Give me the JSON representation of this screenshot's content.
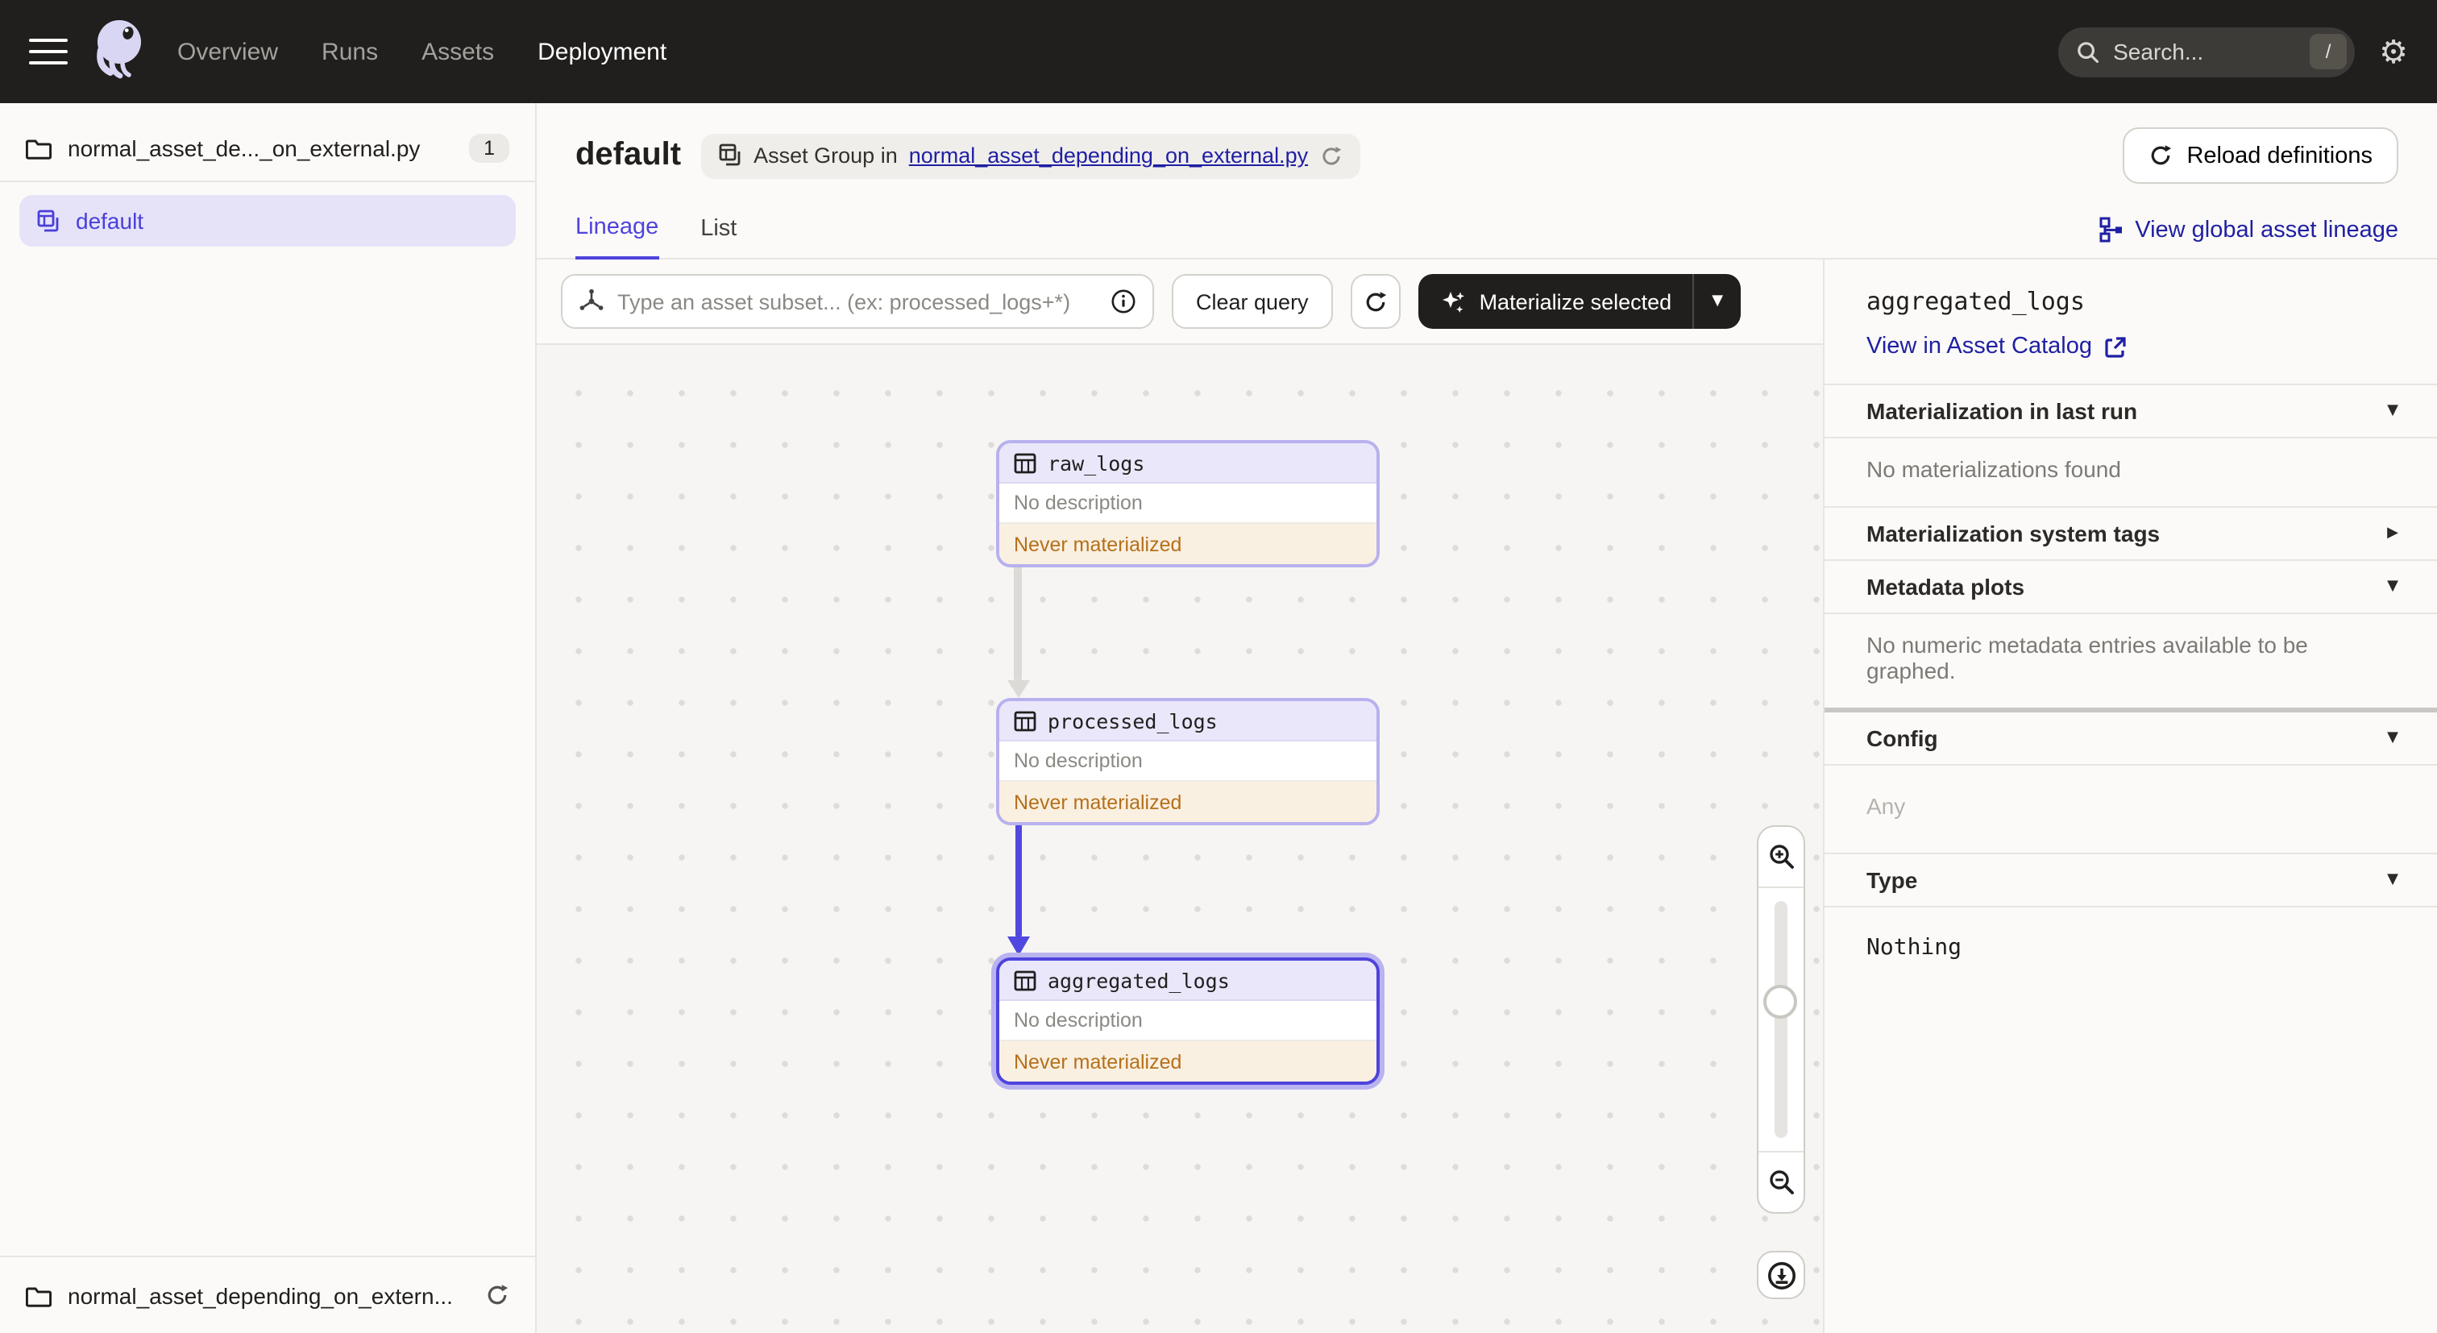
{
  "topnav": {
    "items": [
      {
        "label": "Overview",
        "active": false
      },
      {
        "label": "Runs",
        "active": false
      },
      {
        "label": "Assets",
        "active": false
      },
      {
        "label": "Deployment",
        "active": true
      }
    ],
    "search": {
      "placeholder": "Search...",
      "shortcut": "/"
    }
  },
  "sidebar": {
    "top_item": {
      "label": "normal_asset_de..._on_external.py",
      "badge": "1"
    },
    "selected_item": {
      "label": "default"
    },
    "bottom_item": {
      "label": "normal_asset_depending_on_extern..."
    }
  },
  "header": {
    "title": "default",
    "group_badge": {
      "prefix": "Asset Group in",
      "link": "normal_asset_depending_on_external.py"
    },
    "reload_button": "Reload definitions"
  },
  "tabs": {
    "lineage": "Lineage",
    "list": "List",
    "global_lineage": "View global asset lineage"
  },
  "toolbar": {
    "query_placeholder": "Type an asset subset... (ex: processed_logs+*)",
    "clear_button": "Clear query",
    "materialize_button": "Materialize selected"
  },
  "graph": {
    "nodes": [
      {
        "name": "raw_logs",
        "description": "No description",
        "status": "Never materialized",
        "selected": false
      },
      {
        "name": "processed_logs",
        "description": "No description",
        "status": "Never materialized",
        "selected": false
      },
      {
        "name": "aggregated_logs",
        "description": "No description",
        "status": "Never materialized",
        "selected": true
      }
    ],
    "edges": [
      {
        "from": "raw_logs",
        "to": "processed_logs",
        "highlighted": false
      },
      {
        "from": "processed_logs",
        "to": "aggregated_logs",
        "highlighted": true
      }
    ]
  },
  "panel": {
    "title": "aggregated_logs",
    "catalog_link": "View in Asset Catalog",
    "sections": {
      "last_run": {
        "label": "Materialization in last run",
        "body": "No materializations found",
        "expanded": true
      },
      "system_tags": {
        "label": "Materialization system tags",
        "expanded": false
      },
      "metadata_plots": {
        "label": "Metadata plots",
        "body": "No numeric metadata entries available to be graphed.",
        "expanded": true
      },
      "config": {
        "label": "Config",
        "body": "Any",
        "expanded": true
      },
      "type": {
        "label": "Type",
        "body": "Nothing",
        "expanded": true
      }
    }
  },
  "colors": {
    "accent": "#4F43DD",
    "link": "#1F1FA3",
    "warning_text": "#B5701B",
    "warning_bg": "#FAF0E1",
    "node_border": "#B8B1EE",
    "edge_active": "#5048E0",
    "edge_inactive": "#DCDAD6",
    "topnav_bg": "#211F1E"
  }
}
